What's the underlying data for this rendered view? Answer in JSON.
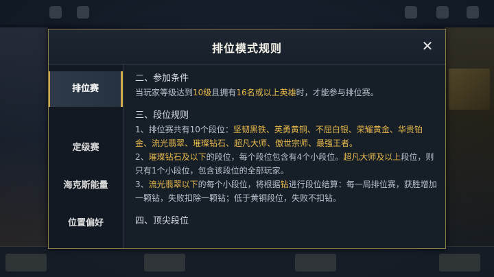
{
  "dialog": {
    "title": "排位模式规则",
    "close_glyph": "✕"
  },
  "sidebar": {
    "items": [
      {
        "label": "排位赛",
        "active": true
      },
      {
        "label": "定级赛",
        "active": false
      },
      {
        "label": "海克斯能量",
        "active": false
      },
      {
        "label": "位置偏好",
        "active": false
      }
    ]
  },
  "content": {
    "section2": {
      "title": "二、参加条件",
      "p1": {
        "t1": "当玩家等级达到",
        "h1": "10级",
        "t2": "且拥有",
        "h2": "16名或以上英雄",
        "t3": "时，才能参与排位赛。"
      }
    },
    "section3": {
      "title": "三、段位规则",
      "p1": {
        "t1": "1、排位赛共有10个段位：",
        "h1": "坚韧黑铁、英勇黄铜、不屈白银、荣耀黄金、华贵铂金、流光翡翠、璀璨钻石、超凡大师、傲世宗师、最强王者。"
      },
      "p2": {
        "t1": "2、",
        "h1": "璀璨钻石及以下",
        "t2": "的段位，每个段位包含有4个小段位。",
        "h2": "超凡大师及以上",
        "t3": "段位，则只有1个小段位，包含该段位的全部玩家。"
      },
      "p3": {
        "t1": "3、",
        "h1": "流光翡翠以下",
        "t2": "的每个小段位，将根据",
        "h2": "钻",
        "t3": "进行段位结算：每一局排位赛，获胜增加一颗钻，失败扣除一颗钻；低于黄铜段位，失败不扣钻。"
      }
    },
    "section4": {
      "title": "四、顶尖段位"
    }
  },
  "colors": {
    "highlight": "#e8b94a",
    "border_gold": "#8a7a4a",
    "panel_bg": "#161e28"
  },
  "icons": {
    "close": "close-icon"
  }
}
